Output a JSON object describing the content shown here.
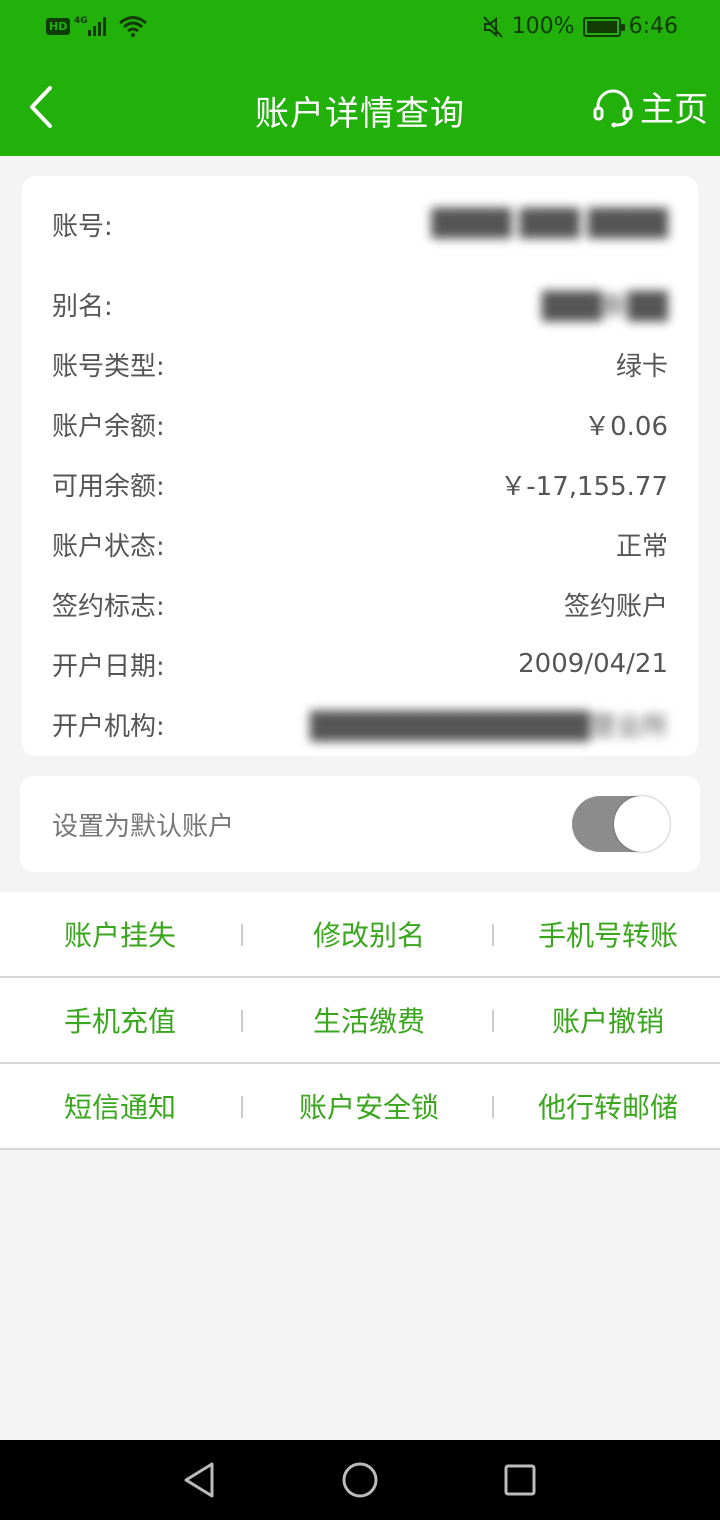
{
  "status_bar": {
    "hd": "HD",
    "network": "4G",
    "battery": "100%",
    "time": "6:46"
  },
  "header": {
    "title": "账户详情查询",
    "home_label": "主页"
  },
  "details": [
    {
      "label": "账号:",
      "value": "████ ███ ████"
    },
    {
      "label": "别名:",
      "value": "███新██"
    },
    {
      "label": "账号类型:",
      "value": "绿卡"
    },
    {
      "label": "账户余额:",
      "value": "￥0.06"
    },
    {
      "label": "可用余额:",
      "value": "￥-17,155.77"
    },
    {
      "label": "账户状态:",
      "value": "正常"
    },
    {
      "label": "签约标志:",
      "value": "签约账户"
    },
    {
      "label": "开户日期:",
      "value": "2009/04/21"
    },
    {
      "label": "开户机构:",
      "value": "██████████████营业所"
    }
  ],
  "default_account": {
    "label": "设置为默认账户",
    "enabled": true
  },
  "actions": [
    [
      "账户挂失",
      "修改别名",
      "手机号转账"
    ],
    [
      "手机充值",
      "生活缴费",
      "账户撤销"
    ],
    [
      "短信通知",
      "账户安全锁",
      "他行转邮储"
    ]
  ],
  "colors": {
    "brand_green": "#22b00a",
    "action_green": "#3aa61e",
    "toggle_gray": "#8c8c8c"
  },
  "icons": [
    "back-icon",
    "headset-icon",
    "back-triangle-icon",
    "home-circle-icon",
    "recents-square-icon"
  ]
}
